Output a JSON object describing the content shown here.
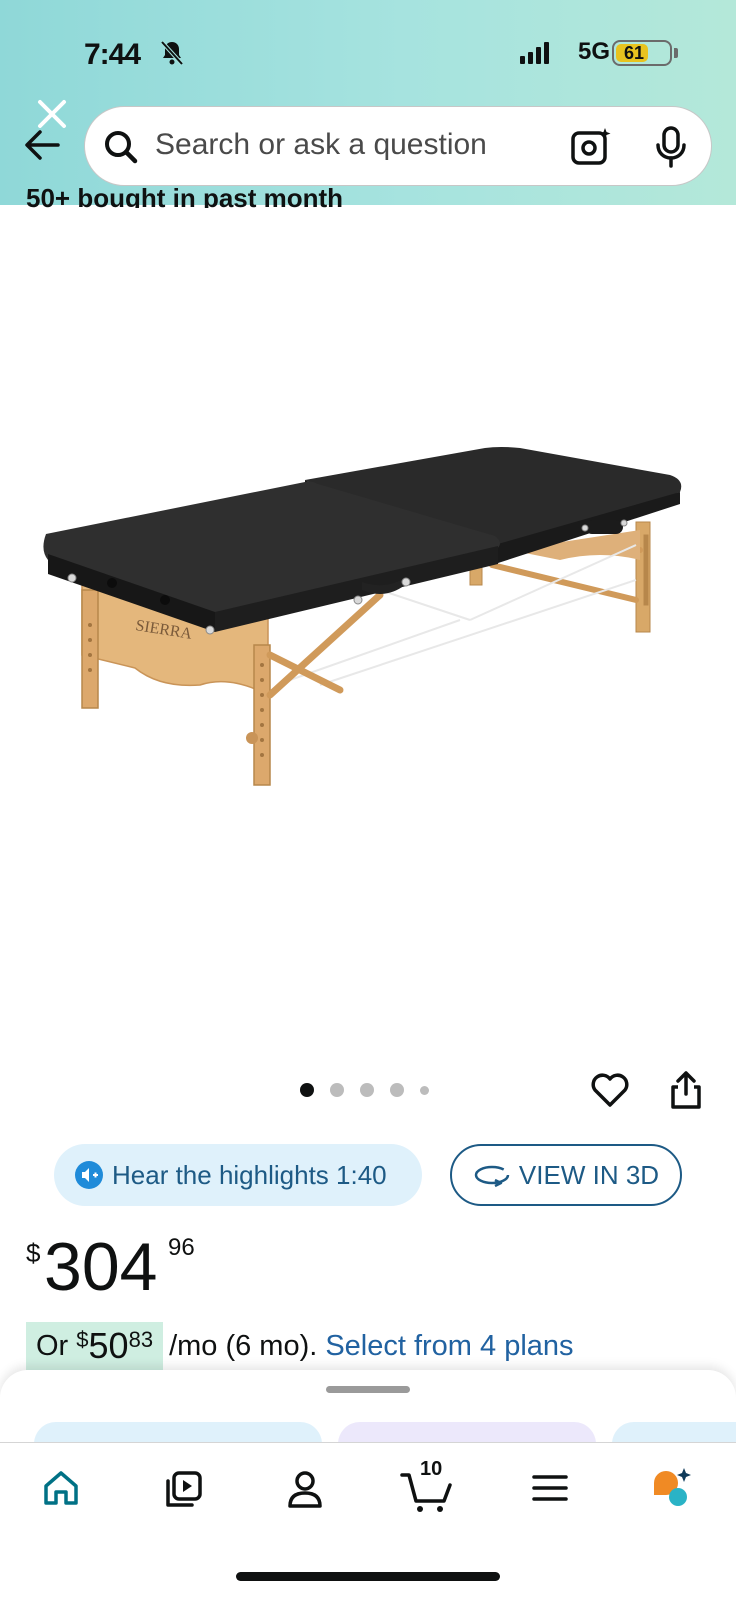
{
  "status_bar": {
    "time": "7:44",
    "network": "5G",
    "battery": "61",
    "battery_level": 0.61
  },
  "search": {
    "placeholder": "Search or ask a question"
  },
  "listing": {
    "truncated_text": "50+ bought in past month",
    "image_count": 5,
    "active_image_index": 0
  },
  "actions": {
    "hear_highlights": "Hear the highlights 1:40",
    "view_3d": "VIEW IN 3D"
  },
  "price": {
    "currency": "$",
    "whole": "304",
    "fraction": "96"
  },
  "installment": {
    "prefix": "Or ",
    "currency": "$",
    "whole": "50",
    "fraction": "83",
    "period": "/mo (6 mo).",
    "link": "Select from 4 plans"
  },
  "tabbar": {
    "items": [
      "home",
      "video",
      "account",
      "cart",
      "menu",
      "rufus"
    ],
    "cart_count": "10",
    "active": "home"
  },
  "colors": {
    "header_gradient_start": "#8fd8d8",
    "header_gradient_end": "#b4e8d9",
    "link_blue": "#2162a1",
    "pill_blue": "#1d5a85",
    "installment_bg": "#cfeee1",
    "active_tab": "#007185"
  },
  "icons": [
    "bell-slash-icon",
    "signal-icon",
    "battery-icon",
    "close-icon",
    "back-arrow-icon",
    "search-icon",
    "camera-icon",
    "microphone-icon",
    "heart-icon",
    "share-icon",
    "speaker-icon",
    "rotate-3d-icon",
    "home-icon",
    "video-icon",
    "account-icon",
    "cart-icon",
    "menu-icon",
    "rufus-icon"
  ]
}
